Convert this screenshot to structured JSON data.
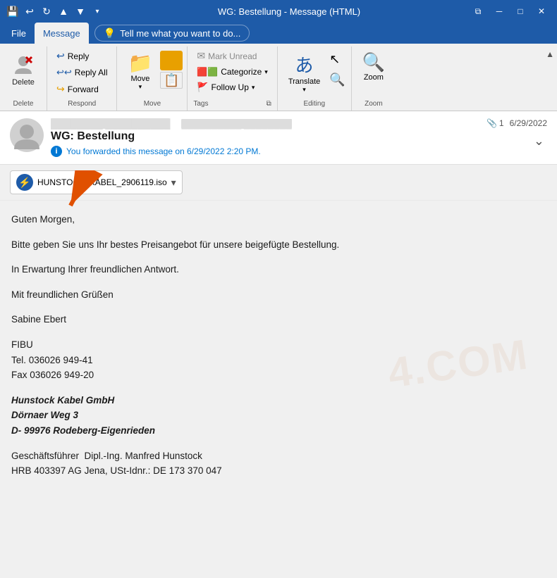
{
  "titleBar": {
    "title": "WG: Bestellung - Message (HTML)",
    "controls": {
      "save": "💾",
      "undo": "↩",
      "redo": "↻",
      "up": "▲",
      "down": "▼",
      "dropdown": "▾"
    },
    "windowControls": {
      "restore": "⧉",
      "minimize": "─",
      "maximize": "□",
      "close": "✕"
    }
  },
  "menuBar": {
    "items": [
      "File",
      "Message"
    ],
    "activeItem": "Message",
    "tellMe": "Tell me what you want to do..."
  },
  "ribbon": {
    "groups": [
      {
        "label": "Delete",
        "buttons": [
          {
            "id": "delete",
            "icon": "✕",
            "label": "Delete",
            "type": "large"
          }
        ]
      },
      {
        "label": "Respond",
        "buttons": [
          {
            "id": "reply",
            "icon": "↩",
            "label": "Reply"
          },
          {
            "id": "reply-all",
            "icon": "↩↩",
            "label": "Reply All"
          },
          {
            "id": "forward",
            "icon": "↪",
            "label": "Forward"
          }
        ]
      },
      {
        "label": "Move",
        "buttons": [
          {
            "id": "move",
            "icon": "📁",
            "label": "Move"
          }
        ]
      },
      {
        "label": "Tags",
        "buttons": [
          {
            "id": "mark-unread",
            "icon": "✉",
            "label": "Mark Unread"
          },
          {
            "id": "categorize",
            "icon": "🟦",
            "label": "Categorize"
          },
          {
            "id": "follow-up",
            "icon": "🚩",
            "label": "Follow Up"
          }
        ]
      },
      {
        "label": "Editing",
        "buttons": [
          {
            "id": "translate",
            "icon": "あ",
            "label": "Translate"
          },
          {
            "id": "pointer",
            "icon": "↖",
            "label": ""
          },
          {
            "id": "search",
            "icon": "🔍",
            "label": ""
          }
        ]
      },
      {
        "label": "Zoom",
        "buttons": [
          {
            "id": "zoom",
            "icon": "🔍",
            "label": "Zoom"
          }
        ]
      }
    ]
  },
  "email": {
    "sender": "██████ ██████████",
    "to": "██████████ ████████",
    "subject": "WG: Bestellung",
    "forwardedNotice": "You forwarded this message on 6/29/2022 2:20 PM.",
    "attachmentCount": "1",
    "date": "6/29/2022",
    "attachment": {
      "name": "HUNSTOCK_KABEL_2906119.iso",
      "icon": "⚡"
    },
    "body": [
      {
        "type": "p",
        "text": "Guten Morgen,"
      },
      {
        "type": "p",
        "text": "Bitte geben Sie uns Ihr bestes Preisangebot für unsere beigefügte Bestellung."
      },
      {
        "type": "p",
        "text": "In Erwartung Ihrer freundlichen Antwort."
      },
      {
        "type": "p",
        "text": "Mit freundlichen Grüßen"
      },
      {
        "type": "p",
        "text": "Sabine Ebert"
      },
      {
        "type": "p",
        "text": "FIBU\nTel. 036026 949-41\nFax 036026 949-20"
      },
      {
        "type": "bold",
        "text": "Hunstock Kabel GmbH\nDörnaer Weg 3\nD- 99976 Rodeberg-Eigenrieden"
      },
      {
        "type": "p",
        "text": ""
      },
      {
        "type": "p",
        "text": "Geschäftsführer  Dipl.-Ing. Manfred Hunstock\nHRB 403397 AG Jena, USt-Idnr.: DE 173 370 047"
      }
    ]
  }
}
